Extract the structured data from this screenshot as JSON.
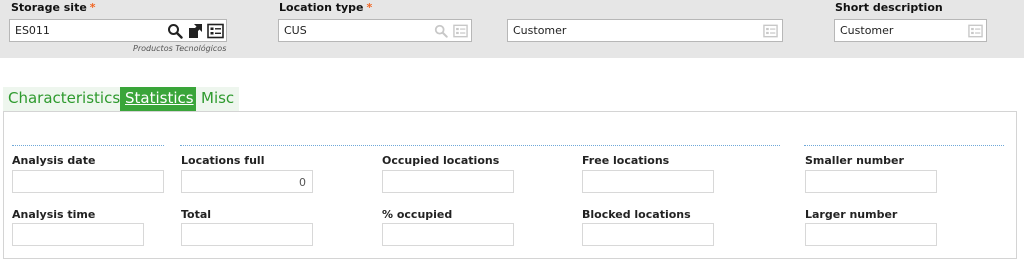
{
  "header": {
    "storage_site": {
      "label": "Storage site",
      "value": "ES011",
      "caption": "Productos Tecnológicos"
    },
    "location_type": {
      "label": "Location type",
      "value": "CUS",
      "description": "Customer"
    },
    "short_description": {
      "label": "Short description",
      "value": "Customer"
    },
    "required_mark": "*"
  },
  "tabs": [
    {
      "label": "Characteristics",
      "active": false
    },
    {
      "label": "Statistics",
      "active": true
    },
    {
      "label": "Misc",
      "active": false
    }
  ],
  "statistics": {
    "analysis_date": {
      "label": "Analysis date",
      "value": ""
    },
    "analysis_time": {
      "label": "Analysis time",
      "value": ""
    },
    "locations_full": {
      "label": "Locations full",
      "value": "0"
    },
    "total": {
      "label": "Total",
      "value": ""
    },
    "occupied_locations": {
      "label": "Occupied locations",
      "value": ""
    },
    "percent_occupied": {
      "label": "% occupied",
      "value": ""
    },
    "free_locations": {
      "label": "Free locations",
      "value": ""
    },
    "blocked_locations": {
      "label": "Blocked locations",
      "value": ""
    },
    "smaller_number": {
      "label": "Smaller number",
      "value": ""
    },
    "larger_number": {
      "label": "Larger number",
      "value": ""
    }
  },
  "icons": {
    "lookup": "magnifier-icon",
    "navigate": "zoom-to-record-icon",
    "selection": "selection-list-icon"
  },
  "colors": {
    "required": "#f26522",
    "tab_active_bg": "#3aa53a",
    "tab_text": "#2e9a2e",
    "separator": "#6fa8d8"
  }
}
